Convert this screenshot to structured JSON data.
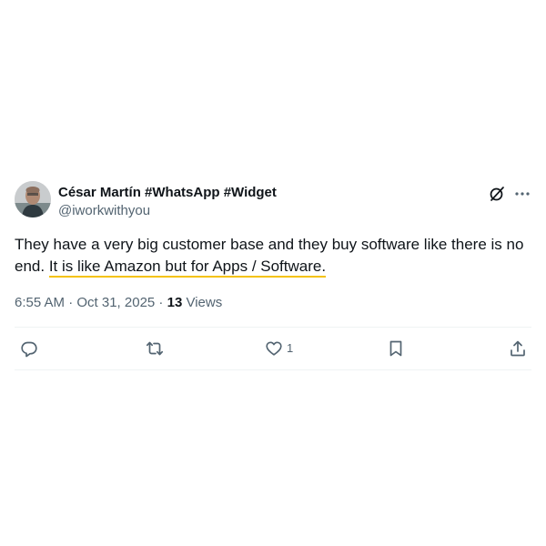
{
  "author": {
    "display_name": "César Martín #WhatsApp #Widget",
    "handle": "@iworkwithyou",
    "avatar_icon": "avatar-photo"
  },
  "tweet": {
    "text_plain": "They have a very big customer base and they buy software like there is no end. ",
    "text_highlighted": "It is like Amazon but for Apps / Software.",
    "highlight_color": "#f4c20d"
  },
  "meta": {
    "timestamp": "6:55 AM · Oct 31, 2025",
    "separator": " · ",
    "views_count": "13",
    "views_label": "Views"
  },
  "actions": {
    "reply_icon": "reply-icon",
    "retweet_icon": "retweet-icon",
    "like_icon": "heart-icon",
    "like_count": "1",
    "bookmark_icon": "bookmark-icon",
    "share_icon": "share-icon"
  },
  "header_icons": {
    "grok": "grok-icon",
    "more": "more-icon"
  },
  "colors": {
    "text_primary": "#0f1419",
    "text_secondary": "#536471",
    "divider": "#eff3f4"
  }
}
